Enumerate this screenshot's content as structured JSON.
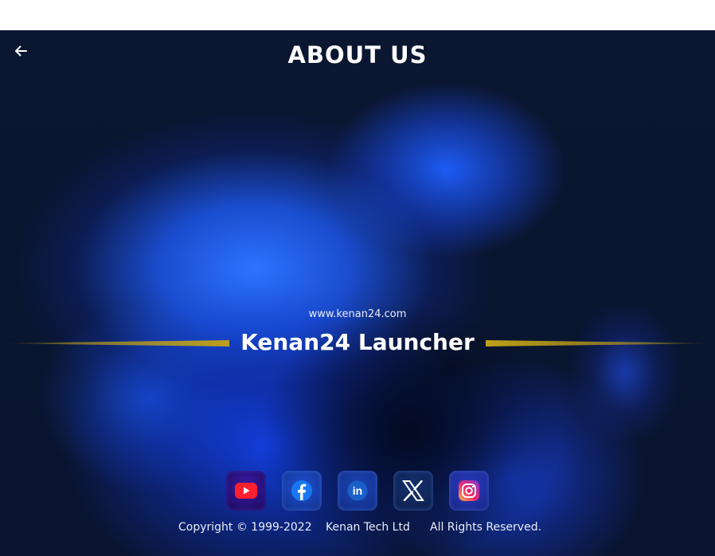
{
  "header": {
    "title": "ABOUT US",
    "back_icon": "arrow-left-icon"
  },
  "about": {
    "website": "www.kenan24.com",
    "app_name": "Kenan24 Launcher",
    "accent_color": "#bfa01a"
  },
  "social": [
    {
      "name": "YouTube",
      "icon": "youtube-icon"
    },
    {
      "name": "Facebook",
      "icon": "facebook-icon"
    },
    {
      "name": "LinkedIn",
      "icon": "linkedin-icon",
      "text": "in"
    },
    {
      "name": "X",
      "icon": "x-icon"
    },
    {
      "name": "Instagram",
      "icon": "instagram-icon"
    }
  ],
  "footer": {
    "copyright": "Copyright © 1999-2022",
    "company": "Kenan Tech Ltd",
    "rights": "All Rights Reserved."
  }
}
